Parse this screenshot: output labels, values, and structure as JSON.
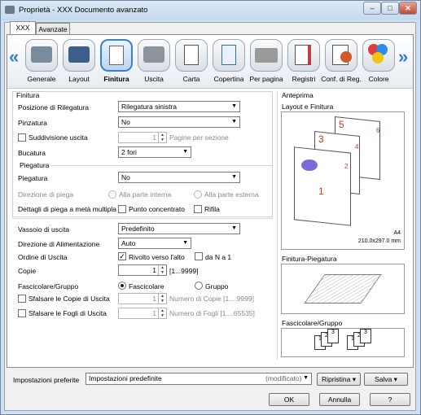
{
  "window": {
    "title": "Proprietà - XXX Documento avanzato"
  },
  "titlebar_buttons": {
    "minimize": "–",
    "maximize": "□",
    "close": "✕"
  },
  "tabs": [
    "XXX",
    "Avanzate"
  ],
  "nav": {
    "left_arrow": "«",
    "right_arrow": "»"
  },
  "categories": [
    "Generale",
    "Layout",
    "Finitura",
    "Uscita",
    "Carta",
    "Copertina",
    "Per pagina",
    "Registri",
    "Conf. di Reg.",
    "Colore"
  ],
  "selected_category": "Finitura",
  "finitura": {
    "section_title": "Finitura",
    "posizione_label": "Posizione di Rilegatura",
    "posizione_value": "Rilegatura sinistra",
    "pinzatura_label": "Pinzatura",
    "pinzatura_value": "No",
    "suddivisione_label": "Suddivisione uscita",
    "suddivisione_value": "1",
    "suddivisione_unit": "Pagine per sezione",
    "bucatura_label": "Bucatura",
    "bucatura_value": "2 fori",
    "piegatura_section": "Piegatura",
    "piegatura_label": "Piegatura",
    "piegatura_value": "No",
    "direzione_piega_label": "Direzione di piega",
    "parte_interna": "Alla parte interna",
    "parte_esterna": "Alla parte esterna",
    "dettagli_label": "Dettagli di piega a metà multipla",
    "punto_concentrato": "Punto concentrato",
    "rifila": "Rifila"
  },
  "uscita": {
    "vassoio_label": "Vassoio di uscita",
    "vassoio_value": "Predefinito",
    "direzione_alim_label": "Direzione di Alimentazione",
    "direzione_alim_value": "Auto",
    "ordine_label": "Ordine di Uscita",
    "rivolto_label": "Rivolto verso l'alto",
    "rivolto_checked": "✓",
    "da_n_a_1_label": "da N a 1",
    "copie_label": "Copie",
    "copie_value": "1",
    "copie_range": "[1...9999]",
    "fascicolare_label": "Fascicolare/Gruppo",
    "fascicolare_opt": "Fascicolare",
    "gruppo_opt": "Gruppo",
    "sfalsare_copie_label": "Sfalsare le Copie di Uscita",
    "sfalsare_copie_value": "1",
    "sfalsare_copie_hint": "Numero di Copie [1....9999]",
    "sfalsare_fogli_label": "Sfalsare le Fogli di Uscita",
    "sfalsare_fogli_value": "1",
    "sfalsare_fogli_hint": "Numero di Fogli [1....65535]"
  },
  "anteprima": {
    "title": "Anteprima",
    "layout_title": "Layout e Finitura",
    "paper": "A4",
    "paper_size": "210.0x297.0 mm",
    "page_numbers": [
      "1",
      "2",
      "3",
      "4",
      "5",
      "6"
    ],
    "finitura_piegatura": "Finitura-Piegatura",
    "fascicolare_gruppo": "Fascicolare/Gruppo",
    "collate_numbers": [
      "1",
      "2",
      "3"
    ]
  },
  "footer": {
    "impostazioni_label": "Impostazioni preferite",
    "impostazioni_value": "Impostazioni predefinite",
    "modificato": "(modificato)",
    "ripristina": "Ripristina",
    "salva": "Salva",
    "ok": "OK",
    "annulla": "Annulla",
    "help": "?"
  },
  "colors": {
    "accent": "#3c7fd0",
    "window_frame": "#cfe0f2",
    "page_number": "#c0392b"
  }
}
